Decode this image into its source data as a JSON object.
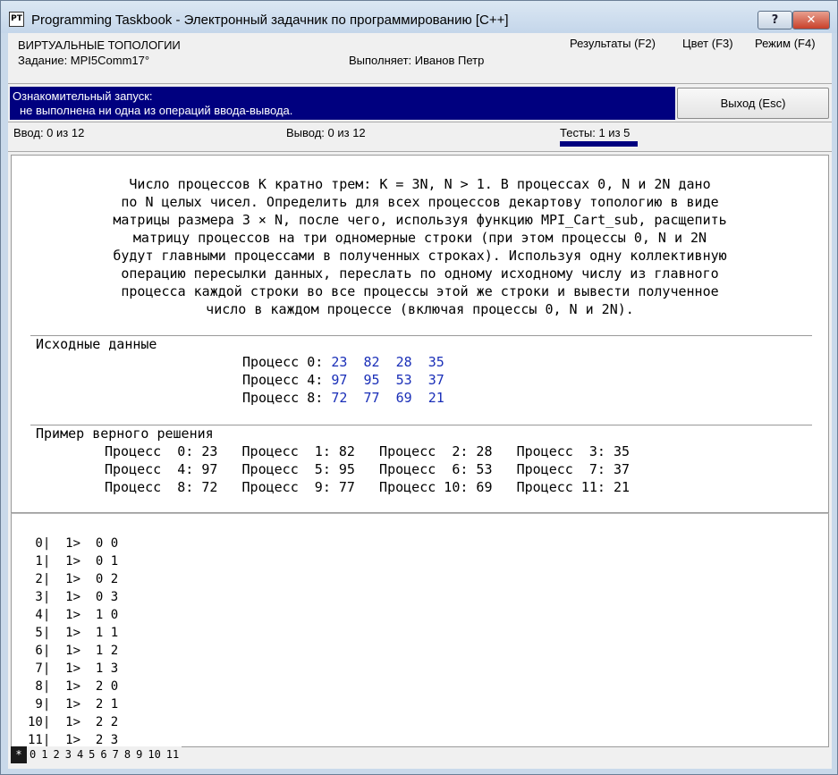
{
  "window": {
    "title": "Programming Taskbook - Электронный задачник по программированию [C++]",
    "icon_label": "PT",
    "help_label": "?",
    "close_label": "✕"
  },
  "header": {
    "topic": "ВИРТУАЛЬНЫЕ ТОПОЛОГИИ",
    "task": "Задание: MPI5Comm17°",
    "performer": "Выполняет: Иванов Петр",
    "menu_results": "Результаты (F2)",
    "menu_color": "Цвет (F3)",
    "menu_mode": "Режим (F4)"
  },
  "status": {
    "line1": "Ознакомительный запуск:",
    "line2": "не выполнена ни одна из операций ввода-вывода.",
    "exit_label": "Выход (Esc)"
  },
  "counters": {
    "input": "Ввод: 0 из 12",
    "output": "Вывод: 0 из 12",
    "tests": "Тесты: 1 из 5"
  },
  "description": [
    "Число процессов K кратно трем: K = 3N, N > 1. В процессах 0, N и 2N дано",
    "по N целых чисел. Определить для всех процессов декартову топологию в виде",
    "матрицы размера 3 × N, после чего, используя функцию MPI_Cart_sub, расщепить",
    "матрицу процессов на три одномерные строки (при этом процессы 0, N и 2N",
    "будут главными процессами в полученных строках). Используя одну коллективную",
    "операцию пересылки данных, переслать по одному исходному числу из главного",
    "процесса каждой строки во все процессы этой же строки и вывести полученное",
    "число в каждом процессе (включая процессы 0, N и 2N)."
  ],
  "input_section": {
    "title": "Исходные данные",
    "rows": [
      {
        "label": "Процесс 0:",
        "values": "23  82  28  35"
      },
      {
        "label": "Процесс 4:",
        "values": "97  95  53  37"
      },
      {
        "label": "Процесс 8:",
        "values": "72  77  69  21"
      }
    ]
  },
  "example_section": {
    "title": "Пример верного решения",
    "rows": [
      "Процесс  0: 23   Процесс  1: 82   Процесс  2: 28   Процесс  3: 35",
      "Процесс  4: 97   Процесс  5: 95   Процесс  6: 53   Процесс  7: 37",
      "Процесс  8: 72   Процесс  9: 77   Процесс 10: 69   Процесс 11: 21"
    ]
  },
  "output_lines": [
    " 0|  1>  0 0",
    " 1|  1>  0 1",
    " 2|  1>  0 2",
    " 3|  1>  0 3",
    " 4|  1>  1 0",
    " 5|  1>  1 1",
    " 6|  1>  1 2",
    " 7|  1>  1 3",
    " 8|  1>  2 0",
    " 9|  1>  2 1",
    "10|  1>  2 2",
    "11|  1>  2 3"
  ],
  "process_tabs": [
    "*",
    "0",
    "1",
    "2",
    "3",
    "4",
    "5",
    "6",
    "7",
    "8",
    "9",
    "10",
    "11"
  ]
}
